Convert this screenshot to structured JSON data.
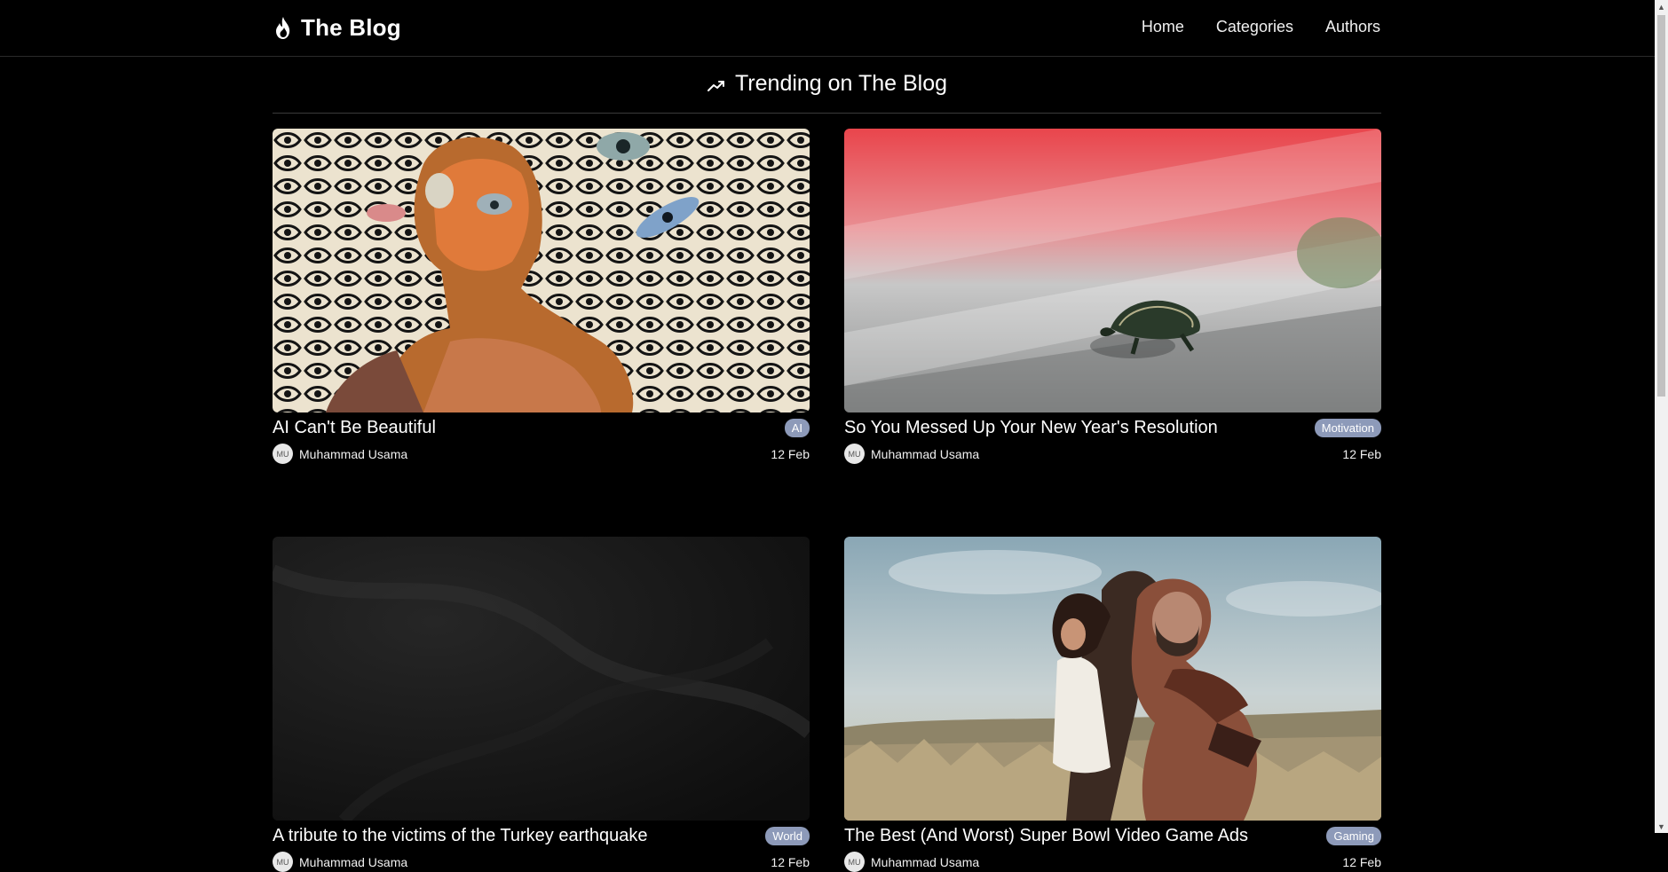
{
  "brand": {
    "title": "The Blog",
    "icon": "flame-icon"
  },
  "nav": {
    "links": [
      {
        "label": "Home"
      },
      {
        "label": "Categories"
      },
      {
        "label": "Authors"
      }
    ]
  },
  "trending": {
    "title": "Trending on The Blog",
    "icon": "trending-up-icon"
  },
  "posts": [
    {
      "title": "AI Can't Be Beautiful",
      "category": "AI",
      "author": "Muhammad Usama",
      "author_initials": "MU",
      "date": "12 Feb",
      "image": "surreal-painting-with-eyes"
    },
    {
      "title": "So You Messed Up Your New Year's Resolution",
      "category": "Motivation",
      "author": "Muhammad Usama",
      "author_initials": "MU",
      "date": "12 Feb",
      "image": "turtle-on-ledge"
    },
    {
      "title": "A tribute to the victims of the Turkey earthquake",
      "category": "World",
      "author": "Muhammad Usama",
      "author_initials": "MU",
      "date": "12 Feb",
      "image": "black-fabric"
    },
    {
      "title": "The Best (And Worst) Super Bowl Video Game Ads",
      "category": "Gaming",
      "author": "Muhammad Usama",
      "author_initials": "MU",
      "date": "12 Feb",
      "image": "warrior-and-girl-in-field"
    }
  ],
  "colors": {
    "background": "#000000",
    "badge": "#8d9ab9",
    "text": "#ffffff"
  }
}
